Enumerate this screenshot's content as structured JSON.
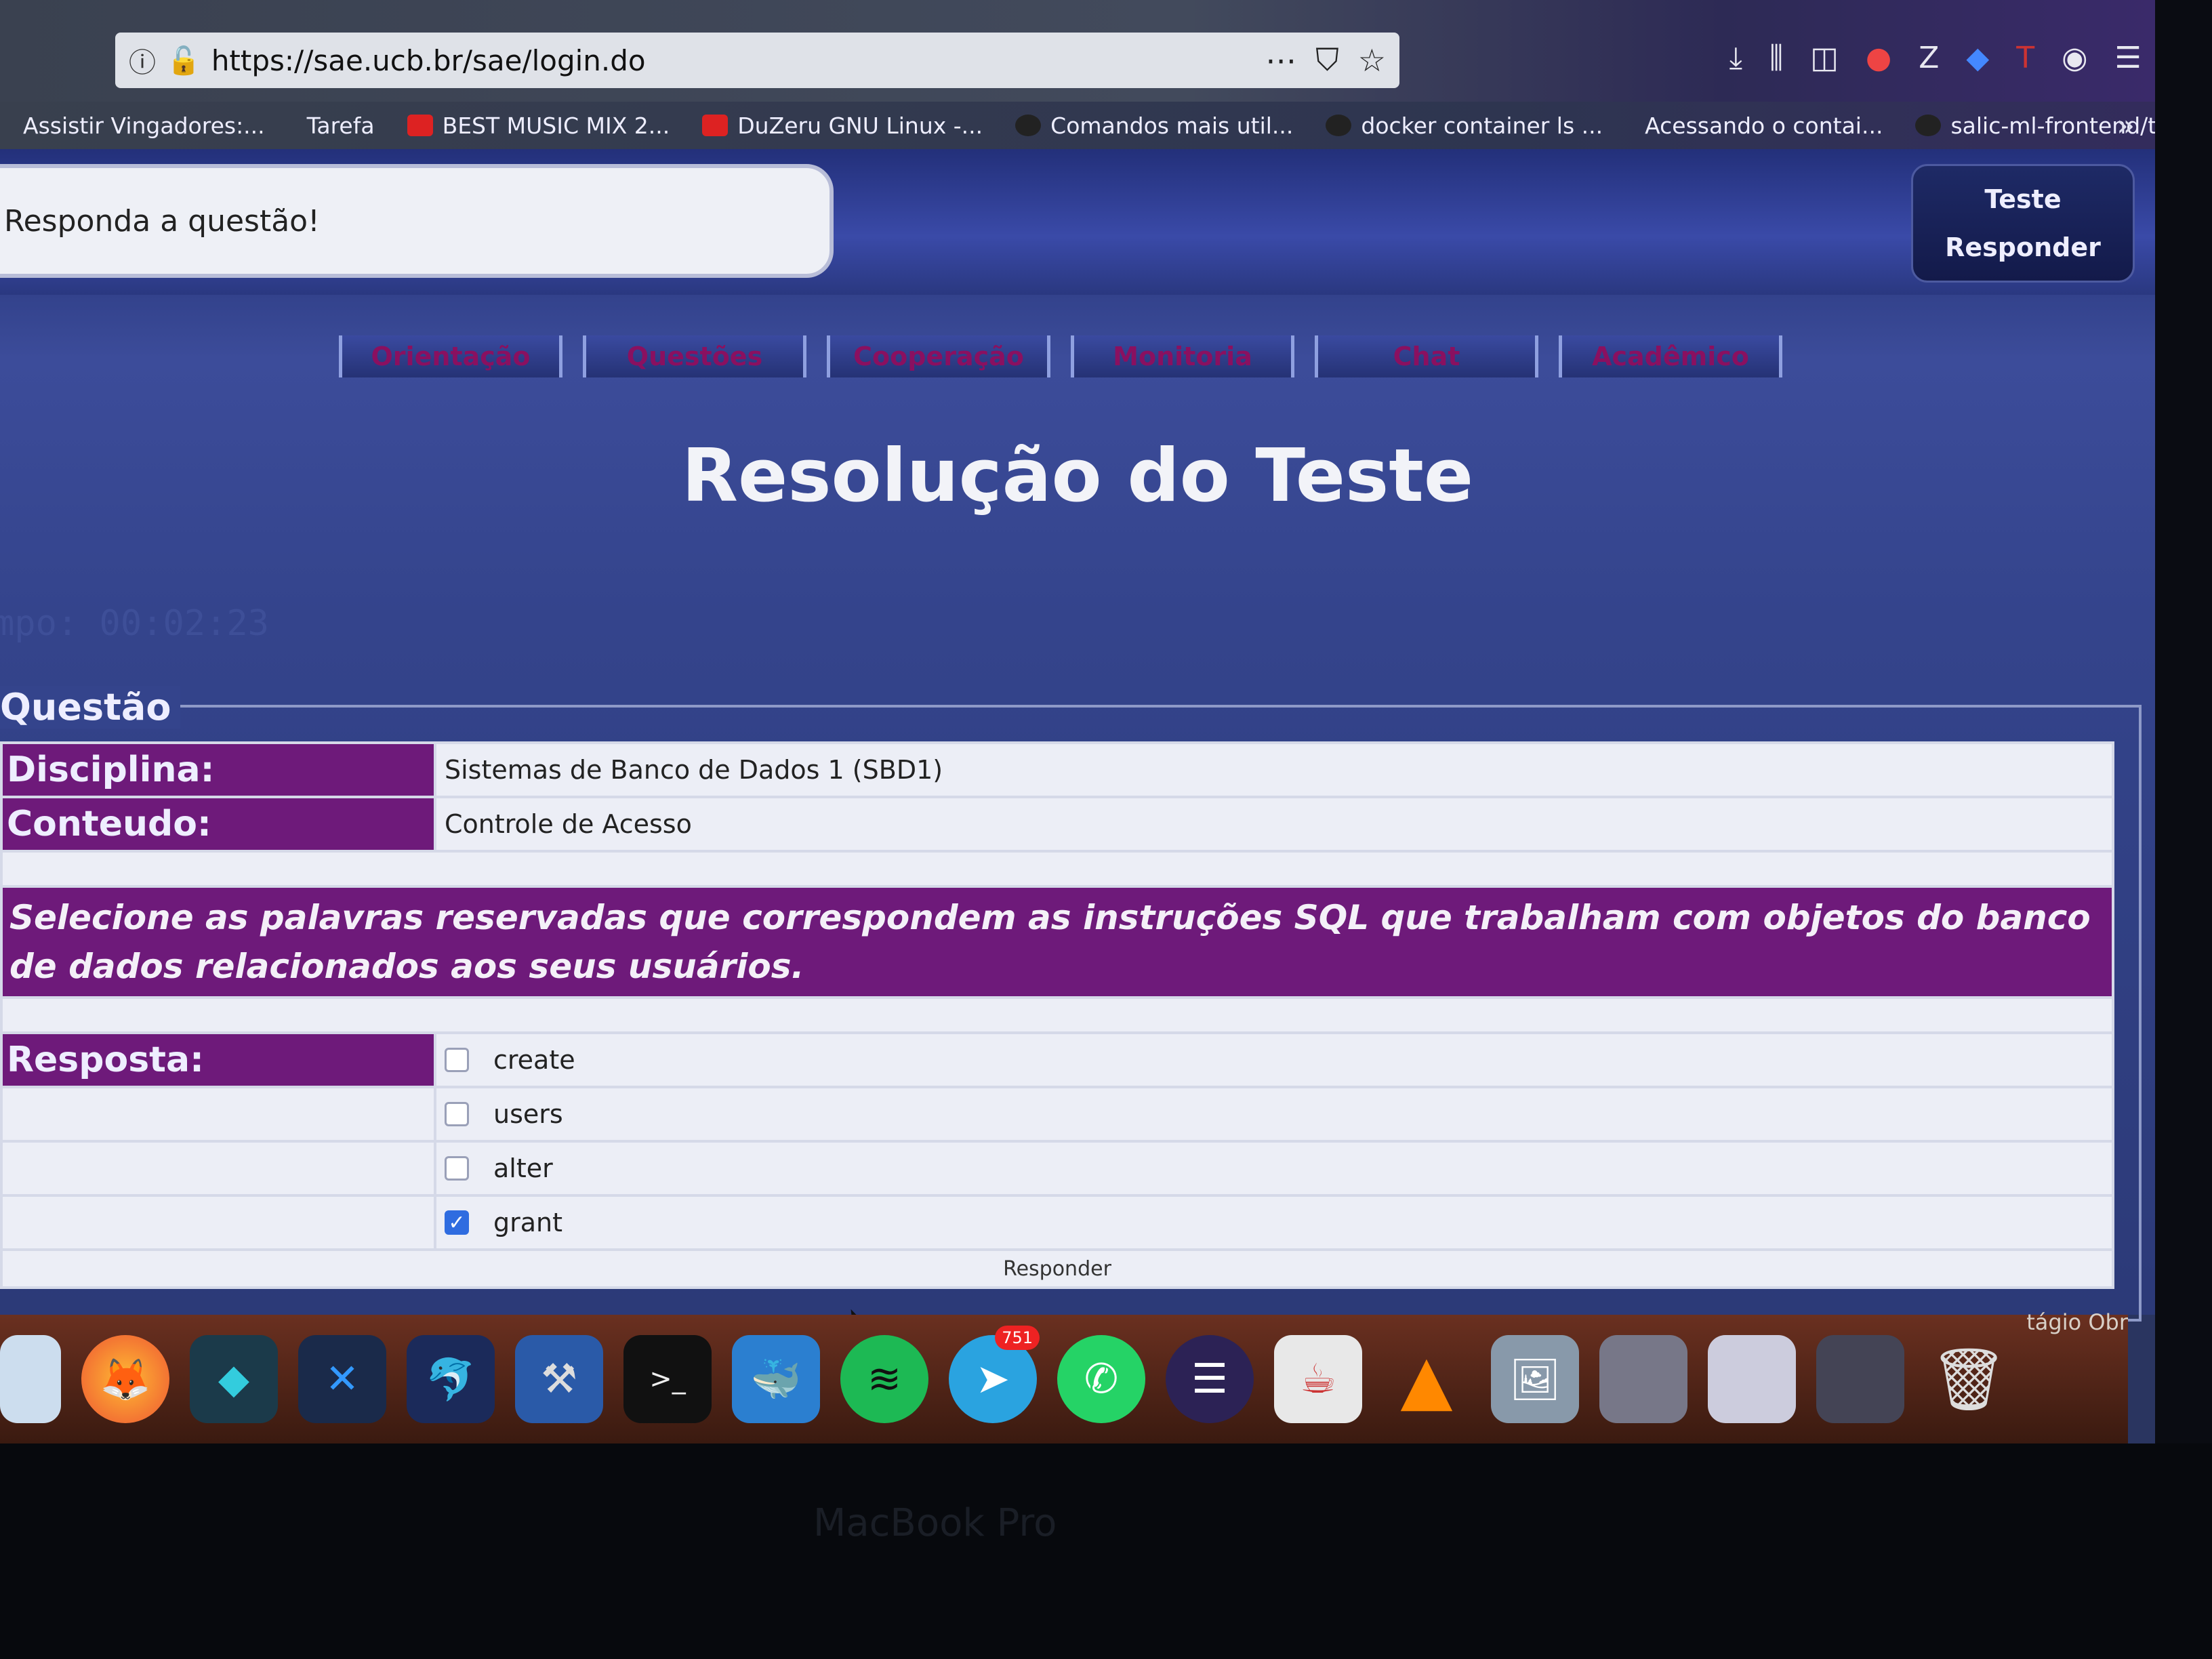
{
  "browser": {
    "url": "https://sae.ucb.br/sae/login.do",
    "bookmarks": [
      "Assistir Vingadores:...",
      "Tarefa",
      "BEST MUSIC MIX 2...",
      "DuZeru GNU Linux -...",
      "Comandos mais util...",
      "docker container ls ...",
      "Acessando o contai...",
      "salic-ml-frontend/t..."
    ]
  },
  "header": {
    "prompt": "Responda a questão!",
    "side_buttons": [
      "Teste",
      "Responder"
    ]
  },
  "nav": [
    "Orientação",
    "Questões",
    "Cooperação",
    "Monitoria",
    "Chat",
    "Acadêmico"
  ],
  "page_title": "Resolução do Teste",
  "timer": "mpo: 00:02:23",
  "question": {
    "legend": "Questão",
    "disciplina_label": "Disciplina:",
    "disciplina_value": "Sistemas de Banco de Dados 1 (SBD1)",
    "conteudo_label": "Conteudo:",
    "conteudo_value": "Controle de Acesso",
    "text": "Selecione as palavras reservadas que correspondem as instruções SQL que trabalham com objetos do banco de dados relacionados aos seus usuários.",
    "resposta_label": "Resposta:",
    "options": [
      {
        "label": "create",
        "checked": false
      },
      {
        "label": "users",
        "checked": false
      },
      {
        "label": "alter",
        "checked": false
      },
      {
        "label": "grant",
        "checked": true
      }
    ],
    "submit": "Responder"
  },
  "dock": {
    "telegram_badge": "751",
    "trash_label": "tágio Obr"
  },
  "bezel_label": "MacBook Pro"
}
